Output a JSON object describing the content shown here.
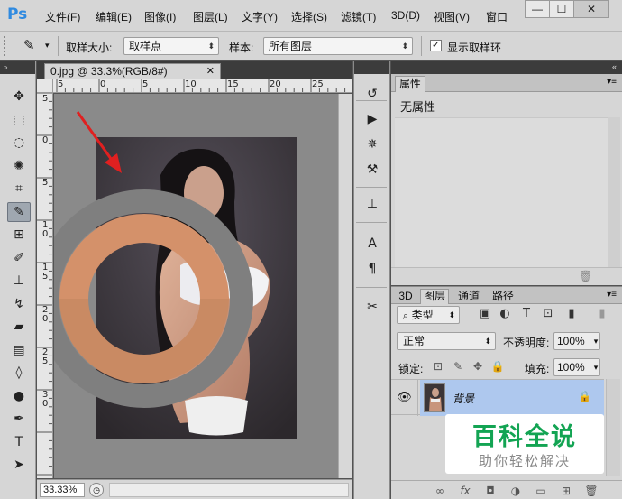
{
  "app": {
    "logo": "Ps"
  },
  "menu": {
    "items": [
      "文件(F)",
      "编辑(E)",
      "图像(I)",
      "图层(L)",
      "文字(Y)",
      "选择(S)",
      "滤镜(T)",
      "3D(D)",
      "视图(V)",
      "窗口"
    ],
    "window_buttons": [
      "—",
      "☐",
      "✕"
    ]
  },
  "options": {
    "sample_size_label": "取样大小:",
    "sample_size_value": "取样点",
    "sample_label": "样本:",
    "sample_value": "所有图层",
    "show_ring_label": "显示取样环",
    "show_ring_checked": "✓"
  },
  "document": {
    "tab_title": "0.jpg @ 33.3%(RGB/8#)",
    "tab_close": "✕",
    "ruler_top": [
      "5",
      "0",
      "5",
      "10",
      "15",
      "20",
      "25"
    ],
    "ruler_left": [
      "5",
      "0",
      "5",
      "1\n0",
      "1\n5",
      "2\n0",
      "2\n5",
      "3\n0"
    ],
    "zoom": "33.33%",
    "ring_colors": {
      "outer": "#7f7f7f",
      "top": "#d4916a",
      "bottom": "#c98a63",
      "background": "#8a8a8a"
    }
  },
  "tools": [
    {
      "name": "move-tool-icon",
      "glyph": "✥"
    },
    {
      "name": "marquee-tool-icon",
      "glyph": "⬚"
    },
    {
      "name": "lasso-tool-icon",
      "glyph": "◌"
    },
    {
      "name": "quick-select-tool-icon",
      "glyph": "✺"
    },
    {
      "name": "crop-tool-icon",
      "glyph": "⌗"
    },
    {
      "name": "eyedropper-tool-icon",
      "glyph": "✎"
    },
    {
      "name": "healing-brush-tool-icon",
      "glyph": "⊞"
    },
    {
      "name": "brush-tool-icon",
      "glyph": "✐"
    },
    {
      "name": "clone-stamp-tool-icon",
      "glyph": "⊥"
    },
    {
      "name": "history-brush-tool-icon",
      "glyph": "↯"
    },
    {
      "name": "eraser-tool-icon",
      "glyph": "▰"
    },
    {
      "name": "gradient-tool-icon",
      "glyph": "▤"
    },
    {
      "name": "blur-tool-icon",
      "glyph": "◊"
    },
    {
      "name": "dodge-tool-icon",
      "glyph": "●"
    },
    {
      "name": "pen-tool-icon",
      "glyph": "✒"
    },
    {
      "name": "type-tool-icon",
      "glyph": "T"
    },
    {
      "name": "path-select-tool-icon",
      "glyph": "➤"
    }
  ],
  "dock_icons": [
    {
      "name": "history-panel-icon",
      "glyph": "↺"
    },
    {
      "name": "actions-panel-icon",
      "glyph": "▶"
    },
    {
      "name": "brush-presets-panel-icon",
      "glyph": "✵"
    },
    {
      "name": "tool-presets-panel-icon",
      "glyph": "⚒"
    },
    {
      "name": "clone-source-panel-icon",
      "glyph": "⊥"
    },
    {
      "name": "character-panel-icon",
      "glyph": "A"
    },
    {
      "name": "paragraph-panel-icon",
      "glyph": "¶"
    },
    {
      "name": "adjust-panel-icon",
      "glyph": "✂"
    }
  ],
  "properties": {
    "tab": "属性",
    "content": "无属性",
    "menu_icon": "▾≡",
    "trash_icon": "🗑"
  },
  "layers": {
    "tabs": [
      "3D",
      "图层",
      "通道",
      "路径"
    ],
    "menu_icon": "▾≡",
    "filter_kind": "类型",
    "filter_icons": [
      "▣",
      "◐",
      "T",
      "⊡",
      "▮"
    ],
    "blend_mode": "正常",
    "opacity_label": "不透明度:",
    "opacity_value": "100%",
    "lock_label": "锁定:",
    "lock_icons": [
      "⊡",
      "✎",
      "✥",
      "🔒"
    ],
    "fill_label": "填充:",
    "fill_value": "100%",
    "layer_name": "背景",
    "layer_visibility_icon": "👁",
    "layer_lock_icon": "🔒",
    "footer_icons": [
      "∞",
      "fx",
      "◘",
      "◑",
      "▭",
      "⊞",
      "🗑"
    ]
  },
  "watermark": {
    "title": "百科全说",
    "subtitle": "助你轻松解决"
  }
}
